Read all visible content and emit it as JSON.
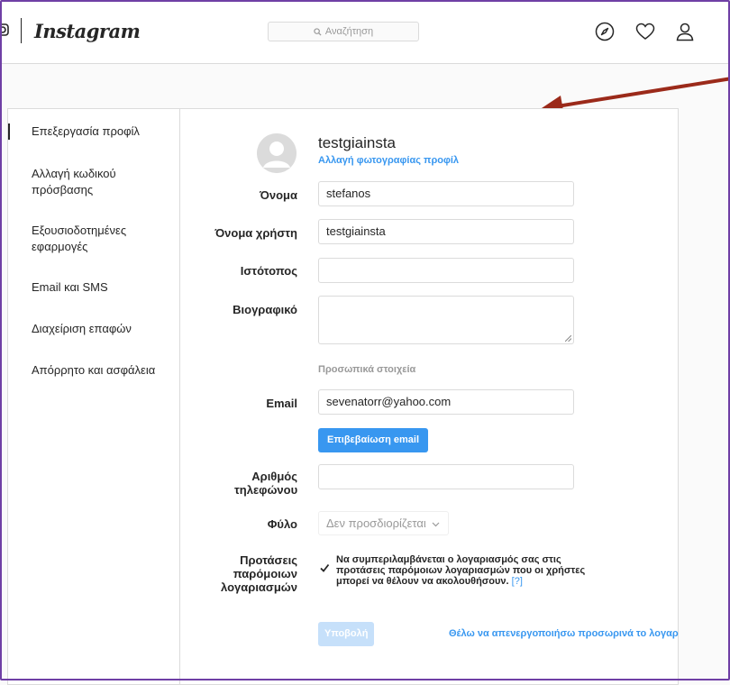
{
  "header": {
    "logo": "Instagram",
    "search_placeholder": "Αναζήτηση"
  },
  "sidebar": {
    "items": [
      {
        "label": "Επεξεργασία προφίλ",
        "active": true
      },
      {
        "label": "Αλλαγή κωδικού πρόσβασης"
      },
      {
        "label": "Εξουσιοδοτημένες εφαρμογές"
      },
      {
        "label": "Email και SMS"
      },
      {
        "label": "Διαχείριση επαφών"
      },
      {
        "label": "Απόρρητο και ασφάλεια"
      }
    ]
  },
  "profile": {
    "username": "testgiainsta",
    "change_photo": "Αλλαγή φωτογραφίας προφίλ"
  },
  "form": {
    "name_label": "Όνομα",
    "name_value": "stefanos",
    "username_label": "Όνομα χρήστη",
    "username_value": "testgiainsta",
    "website_label": "Ιστότοπος",
    "website_value": "",
    "bio_label": "Βιογραφικό",
    "bio_value": "",
    "personal_info_heading": "Προσωπικά στοιχεία",
    "email_label": "Email",
    "email_value": "sevenatorr@yahoo.com",
    "confirm_email_button": "Επιβεβαίωση email",
    "phone_label": "Αριθμός τηλεφώνου",
    "phone_value": "",
    "gender_label": "Φύλο",
    "gender_value": "Δεν προσδιορίζεται",
    "suggestions_label": "Προτάσεις παρόμοιων λογαριασμών",
    "suggestions_checked": true,
    "suggestions_text": "Να συμπεριλαμβάνεται ο λογαριασμός σας στις προτάσεις παρόμοιων λογαριασμών που οι χρήστες μπορεί να θέλουν να ακολουθήσουν.",
    "suggestions_help": "[?]",
    "submit_button": "Υποβολή",
    "deactivate_link": "Θέλω να απενεργοποιήσω προσωρινά το λογαριασμό μου"
  },
  "colors": {
    "accent": "#3897f0",
    "annotation_arrow": "#9b2a1a",
    "frame_border": "#6f3fa5"
  }
}
